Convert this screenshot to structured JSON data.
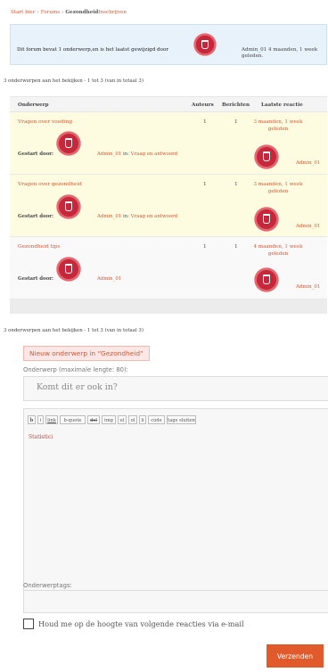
{
  "breadcrumb": {
    "home": "Start hier",
    "sep": "›",
    "forums": "Forums",
    "current": "Gezondheid",
    "action": "Inschrijven"
  },
  "info": {
    "text": "Dit forum bevat 1 onderwerp,en is het laatst gewijzigd door",
    "user": "Admin_01",
    "time": "4 maanden, 1 week geleden."
  },
  "count_top": "3 onderwerpen aan het bekijken - 1 tot 3 (van in totaal 3)",
  "table": {
    "headers": {
      "topic": "Onderwerp",
      "authors": "Auteurs",
      "posts": "Berichten",
      "last": "Laatste reactie"
    },
    "rows": [
      {
        "title": "Vragen over voeding",
        "authors": "1",
        "posts": "1",
        "last": "3 maanden, 1 week geleden",
        "started_label": "Gestart door:",
        "admin": "Admin_01",
        "in_label": "in:",
        "category": "Vraag en antwoord",
        "last_user": "Admin_01"
      },
      {
        "title": "Vragen over gezondheid",
        "authors": "1",
        "posts": "1",
        "last": "3 maanden, 1 week geleden",
        "started_label": "Gestart door:",
        "admin": "Admin_01",
        "in_label": "in:",
        "category": "Vraag en antwoord",
        "last_user": "Admin_01"
      },
      {
        "title": "Gezondheid tips",
        "authors": "1",
        "posts": "1",
        "last": "4 maanden, 1 week geleden",
        "started_label": "Gestart door:",
        "admin": "Admin_01",
        "last_user": "Admin_01"
      }
    ]
  },
  "count_bottom": "3 onderwerpen aan het bekijken - 1 tot 3 (van in totaal 3)",
  "form": {
    "legend": "Nieuw onderwerp in “Gezondheid”",
    "subject_label": "Onderwerp (maximale lengte: 80):",
    "subject_placeholder": "Komt dit er ook in?",
    "toolbar": [
      "b",
      "i",
      "link",
      "b-quote",
      "del",
      "img",
      "ul",
      "ol",
      "li",
      "code",
      "tags sluiten"
    ],
    "body_text": "Statistici",
    "tags_label": "Onderwerptags:",
    "notify_label": "Houd me op de hoogte van volgende reacties via e-mail",
    "submit_label": "Verzenden"
  },
  "colors": {
    "accent": "#e05a2c",
    "link": "#d9552f",
    "row_highlight": "#fdfce1",
    "info_bg": "#e8f2fb"
  }
}
